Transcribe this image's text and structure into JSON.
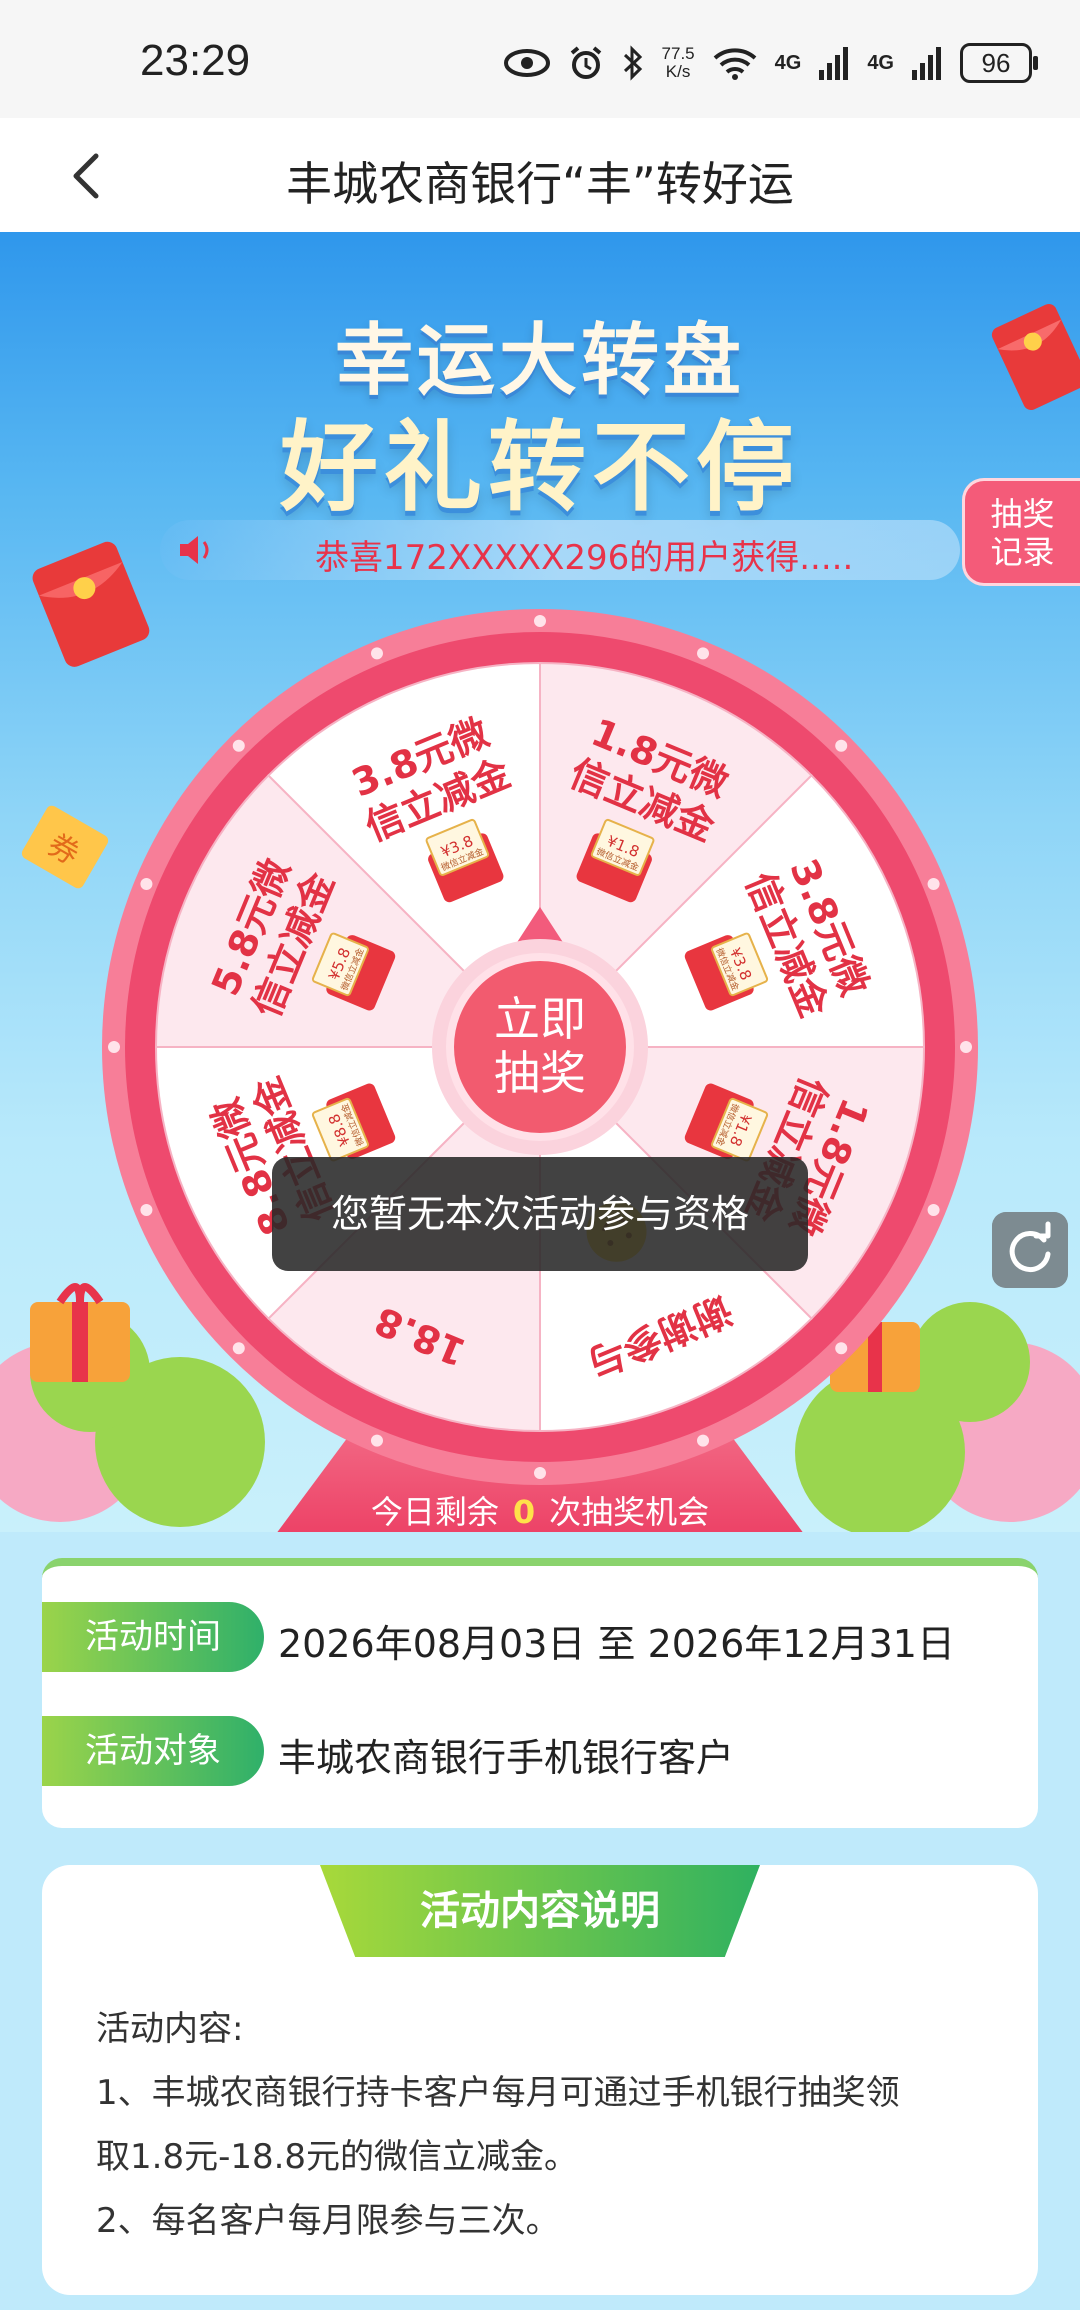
{
  "status_bar": {
    "time": "23:29",
    "net_speed_value": "77.5",
    "net_speed_unit": "K/s",
    "signal1": "4G",
    "signal2": "4G",
    "battery": "96"
  },
  "nav": {
    "title": "丰城农商银行“丰”转好运"
  },
  "hero": {
    "title_line1": "幸运大转盘",
    "title_line2": "好礼转不停",
    "notice": "恭喜172XXXXX296的用户获得.....",
    "record_button": [
      "抽奖",
      "记录"
    ]
  },
  "wheel": {
    "center_button": [
      "立即",
      "抽奖"
    ],
    "prizes": [
      {
        "lines": [
          "1.8元微",
          "信立减金"
        ]
      },
      {
        "lines": [
          "3.8元微",
          "信立减金"
        ]
      },
      {
        "lines": [
          "1.8元微",
          "信立减金"
        ]
      },
      {
        "lines": [
          "谢谢参与"
        ]
      },
      {
        "lines": [
          "18.8"
        ]
      },
      {
        "lines": [
          "8.8元微",
          "信立减金"
        ]
      },
      {
        "lines": [
          "5.8元微",
          "信立减金"
        ]
      },
      {
        "lines": [
          "3.8元微",
          "信立减金"
        ]
      }
    ],
    "coupon_label": "微信立减金",
    "coupon_values": [
      "¥1.8",
      "¥3.8",
      "¥1.8",
      "",
      "",
      "¥8.8",
      "¥5.8",
      "¥3.8"
    ]
  },
  "remaining": {
    "prefix": "今日剩余",
    "count": "0",
    "suffix": "次抽奖机会"
  },
  "toast": "您暂无本次活动参与资格",
  "info": {
    "time_label": "活动时间",
    "time_value": "2026年08月03日 至 2026年12月31日",
    "target_label": "活动对象",
    "target_value": "丰城农商银行手机银行客户"
  },
  "description": {
    "title": "活动内容说明",
    "heading": "活动内容:",
    "line1": "1、丰城农商银行持卡客户每月可通过手机银行抽奖领",
    "line2": "取1.8元-18.8元的微信立减金。",
    "line3": "2、每名客户每月限参与三次。"
  },
  "colors": {
    "accent_red": "#e8334a",
    "green_start": "#9bd44a",
    "green_end": "#2fb06a",
    "wheel_pink": "#f2557a"
  }
}
